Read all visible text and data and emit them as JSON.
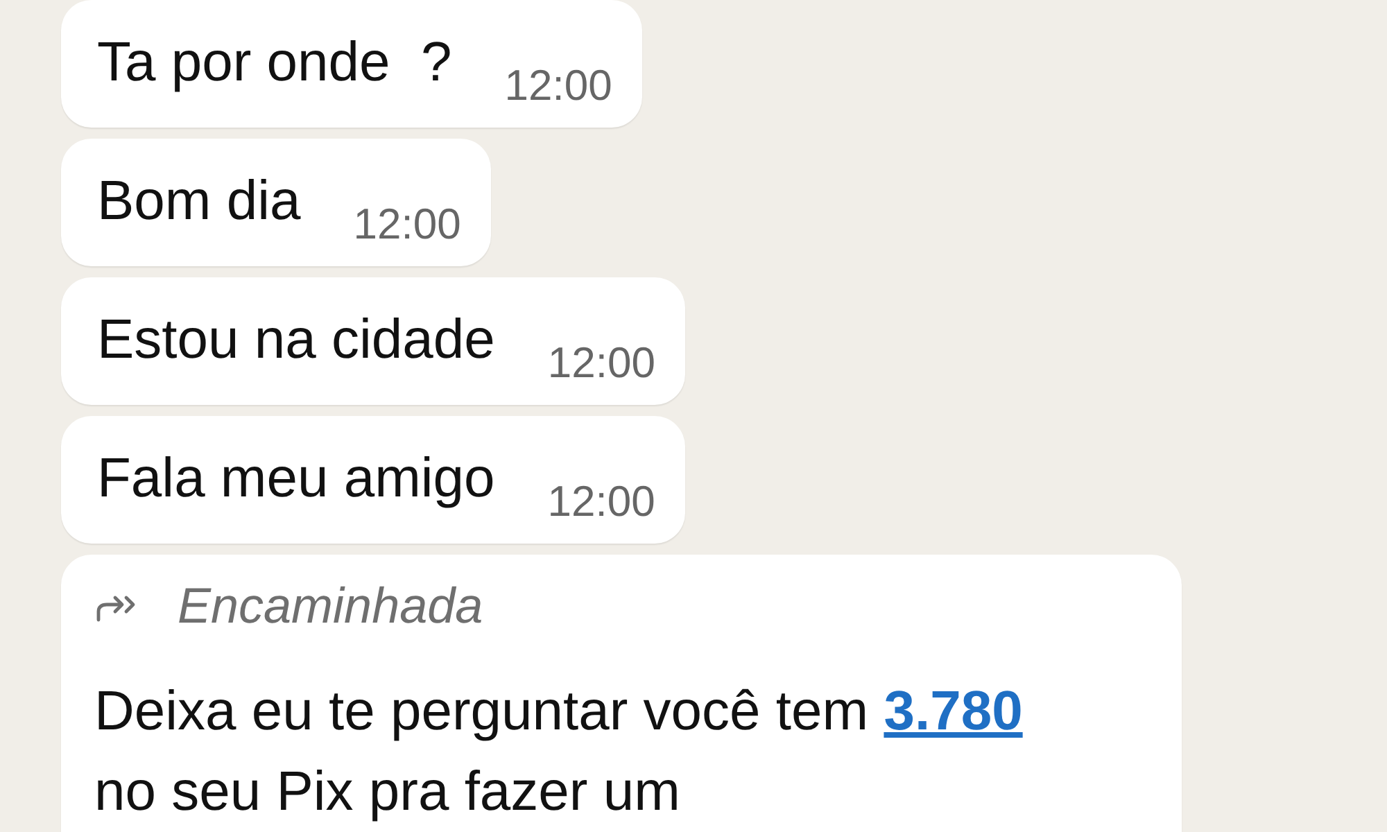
{
  "messages": [
    {
      "kind": "text",
      "text": "Ta por onde  ?",
      "time": "12:00"
    },
    {
      "kind": "text",
      "text": "Bom dia",
      "time": "12:00"
    },
    {
      "kind": "text",
      "text": "Estou na cidade",
      "time": "12:00"
    },
    {
      "kind": "text",
      "text": "Fala meu amigo",
      "time": "12:00"
    },
    {
      "kind": "forwarded",
      "label": "Encaminhada",
      "body": [
        {
          "kind": "text",
          "text": "Deixa eu te perguntar você tem"
        },
        {
          "kind": "link",
          "text": "3.780"
        },
        {
          "kind": "text",
          "text": "no seu Pix pra fazer um"
        }
      ]
    }
  ]
}
